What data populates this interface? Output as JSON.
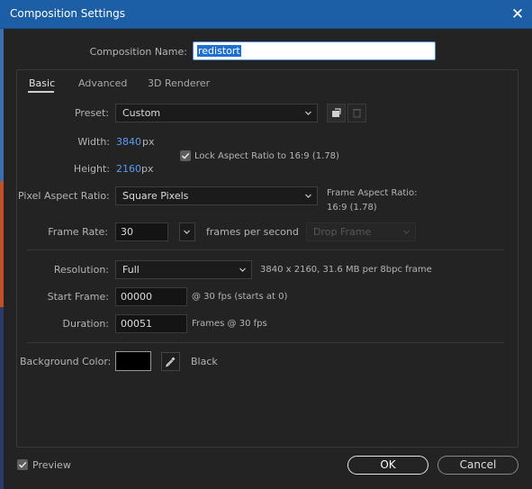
{
  "window": {
    "title": "Composition Settings"
  },
  "composition_name": {
    "label": "Composition Name:",
    "value": "redistort"
  },
  "tabs": [
    {
      "label": "Basic",
      "active": true
    },
    {
      "label": "Advanced",
      "active": false
    },
    {
      "label": "3D Renderer",
      "active": false
    }
  ],
  "preset": {
    "label": "Preset:",
    "value": "Custom"
  },
  "width": {
    "label": "Width:",
    "value": "3840",
    "unit": "px"
  },
  "height": {
    "label": "Height:",
    "value": "2160",
    "unit": "px"
  },
  "lock_aspect": {
    "label": "Lock Aspect Ratio to 16:9 (1.78)",
    "checked": true
  },
  "pixel_aspect": {
    "label": "Pixel Aspect Ratio:",
    "value": "Square Pixels",
    "frame_aspect_label": "Frame Aspect Ratio:",
    "frame_aspect_value": "16:9 (1.78)"
  },
  "frame_rate": {
    "label": "Frame Rate:",
    "value": "30",
    "unit": "frames per second",
    "drop_frame": "Drop Frame"
  },
  "resolution": {
    "label": "Resolution:",
    "value": "Full",
    "info": "3840 x 2160, 31.6 MB per 8bpc frame"
  },
  "start_frame": {
    "label": "Start Frame:",
    "value": "00000",
    "info": "@ 30 fps (starts at 0)"
  },
  "duration": {
    "label": "Duration:",
    "value": "00051",
    "info": "Frames @ 30 fps"
  },
  "background": {
    "label": "Background Color:",
    "color": "#000000",
    "name": "Black"
  },
  "footer": {
    "preview_label": "Preview",
    "preview_checked": true,
    "ok_label": "OK",
    "cancel_label": "Cancel"
  },
  "colors": {
    "titlebar": "#1d5fa6",
    "accent_blue": "#5a9cf0",
    "dialog_bg": "#232323"
  }
}
